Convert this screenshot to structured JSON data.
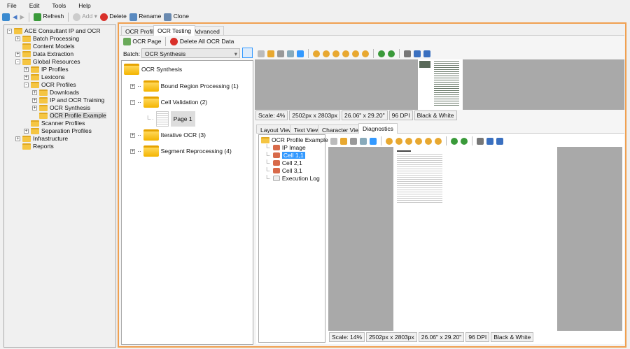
{
  "menu": [
    "File",
    "Edit",
    "Tools",
    "Help"
  ],
  "toolbar": {
    "refresh": "Refresh",
    "add": "Add",
    "delete": "Delete",
    "rename": "Rename",
    "clone": "Clone"
  },
  "nav_tree": [
    {
      "label": "ACE Consultant IP and OCR",
      "level": 0,
      "expander": "-"
    },
    {
      "label": "Batch Processing",
      "level": 1,
      "expander": "+"
    },
    {
      "label": "Content Models",
      "level": 1,
      "expander": ""
    },
    {
      "label": "Data Extraction",
      "level": 1,
      "expander": "+"
    },
    {
      "label": "Global Resources",
      "level": 1,
      "expander": "-"
    },
    {
      "label": "IP Profiles",
      "level": 2,
      "expander": "+"
    },
    {
      "label": "Lexicons",
      "level": 2,
      "expander": "+"
    },
    {
      "label": "OCR Profiles",
      "level": 2,
      "expander": "-"
    },
    {
      "label": "Downloads",
      "level": 3,
      "expander": "+"
    },
    {
      "label": "IP and OCR Training",
      "level": 3,
      "expander": "+"
    },
    {
      "label": "OCR Synthesis",
      "level": 3,
      "expander": "+"
    },
    {
      "label": "OCR Profile Example",
      "level": 3,
      "expander": "",
      "selected": true
    },
    {
      "label": "Scanner Profiles",
      "level": 2,
      "expander": ""
    },
    {
      "label": "Separation Profiles",
      "level": 2,
      "expander": "+"
    },
    {
      "label": "Infrastructure",
      "level": 1,
      "expander": "+"
    },
    {
      "label": "Reports",
      "level": 1,
      "expander": ""
    }
  ],
  "tabs": [
    "OCR Profile",
    "OCR Testing",
    "Advanced"
  ],
  "active_tab": "OCR Testing",
  "testing_toolbar": {
    "ocr_page": "OCR Page",
    "delete_all": "Delete All OCR Data"
  },
  "batch": {
    "label": "Batch:",
    "value": "OCR Synthesis"
  },
  "batch_tree": {
    "root": "OCR Synthesis",
    "children": [
      "Bound Region Processing (1)",
      "Cell Validation (2)",
      "Iterative OCR (3)",
      "Segment Reprocessing (4)"
    ],
    "page": "Page 1"
  },
  "top_status": [
    "Scale: 4%",
    "2502px x 2803px",
    "26.06\" x 29.20\"",
    "96 DPI",
    "Black & White"
  ],
  "view_tabs": [
    "Layout View",
    "Text View",
    "Character View",
    "Diagnostics"
  ],
  "active_view_tab": "Diagnostics",
  "diag_tree": {
    "root": "OCR Profile Example",
    "items": [
      "IP Image",
      "Cell 1,1",
      "Cell 2,1",
      "Cell 3,1",
      "Execution Log"
    ],
    "selected": "Cell 1,1"
  },
  "bottom_status": [
    "Scale: 14%",
    "2502px x 2803px",
    "26.06\" x 29.20\"",
    "96 DPI",
    "Black & White"
  ],
  "colors": {
    "accent_border": "#f0a050",
    "selection": "#3399ff",
    "folder": "#f5c542",
    "viewer_bg": "#a9a9a9"
  }
}
